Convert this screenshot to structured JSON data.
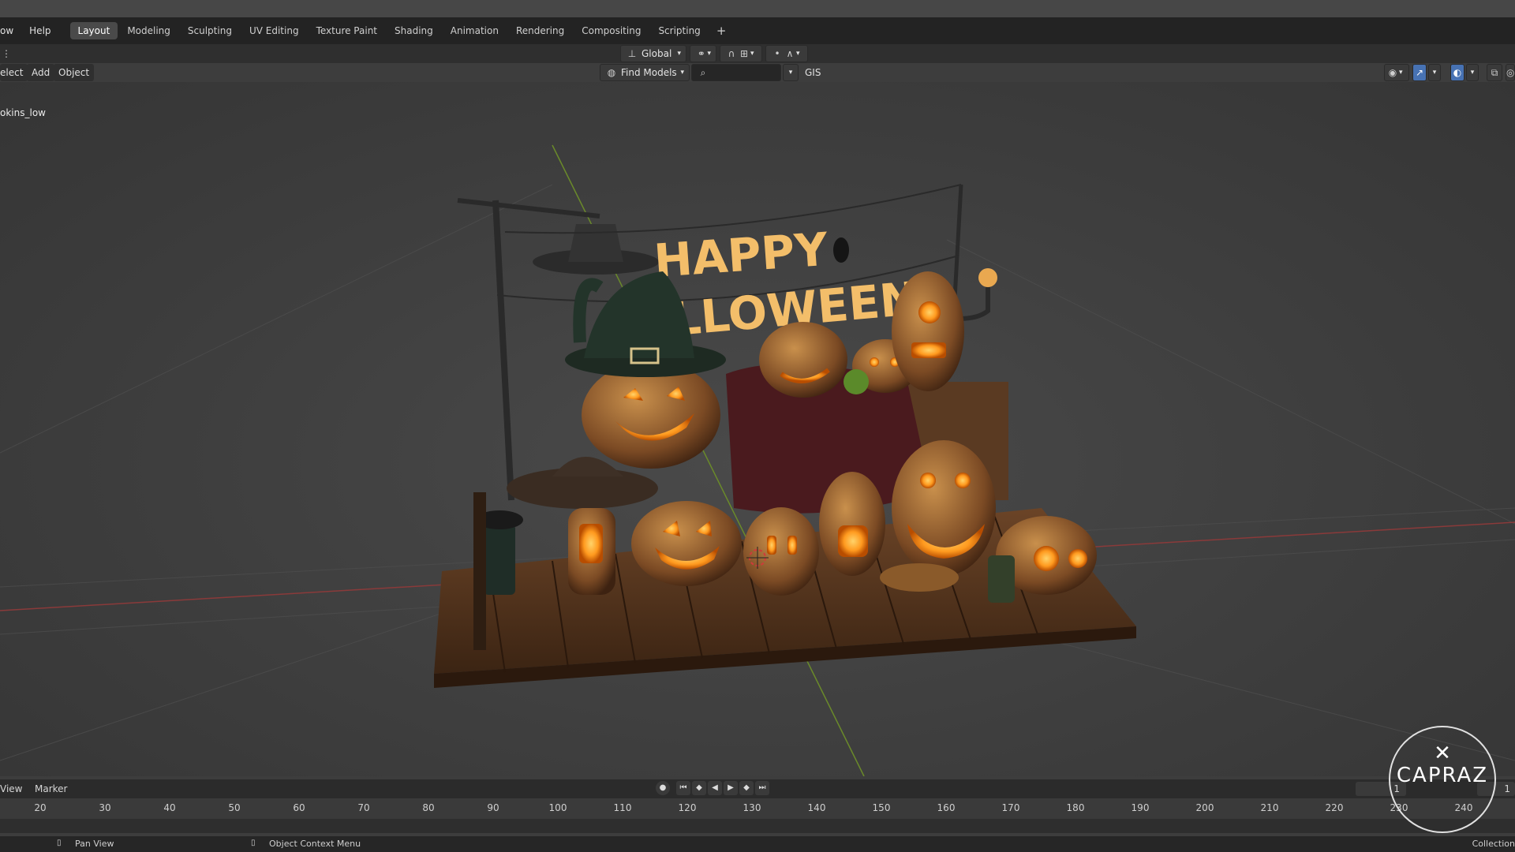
{
  "menus": [
    "ow",
    "Help"
  ],
  "workspace_tabs": [
    {
      "label": "Layout",
      "active": true
    },
    {
      "label": "Modeling"
    },
    {
      "label": "Sculpting"
    },
    {
      "label": "UV Editing"
    },
    {
      "label": "Texture Paint"
    },
    {
      "label": "Shading"
    },
    {
      "label": "Animation"
    },
    {
      "label": "Rendering"
    },
    {
      "label": "Compositing"
    },
    {
      "label": "Scripting"
    }
  ],
  "add_tab_label": "+",
  "header": {
    "transform_orientation": "Global",
    "find_models_label": "Find Models",
    "gis_label": "GIS"
  },
  "viewport_menu": [
    "elect",
    "Add",
    "Object"
  ],
  "object_name": "okins_low",
  "scene": {
    "banner_line1": "HAPPY",
    "banner_line2": "LLOWEEN"
  },
  "timeline": {
    "menu": [
      "View",
      "Marker"
    ],
    "ticks": [
      "20",
      "30",
      "40",
      "50",
      "60",
      "70",
      "80",
      "90",
      "100",
      "110",
      "120",
      "130",
      "140",
      "150",
      "160",
      "170",
      "180",
      "190",
      "200",
      "210",
      "220",
      "230",
      "240"
    ],
    "current_frame": "1",
    "end_frame": "1"
  },
  "status": {
    "pan_view": "Pan View",
    "context_menu": "Object Context Menu",
    "collection": "Collection"
  },
  "watermark": "CAPRAZ",
  "colors": {
    "accent_blue": "#4772b3",
    "pumpkin_glow": "#ff9a1f",
    "banner_text": "#f3be6a"
  }
}
